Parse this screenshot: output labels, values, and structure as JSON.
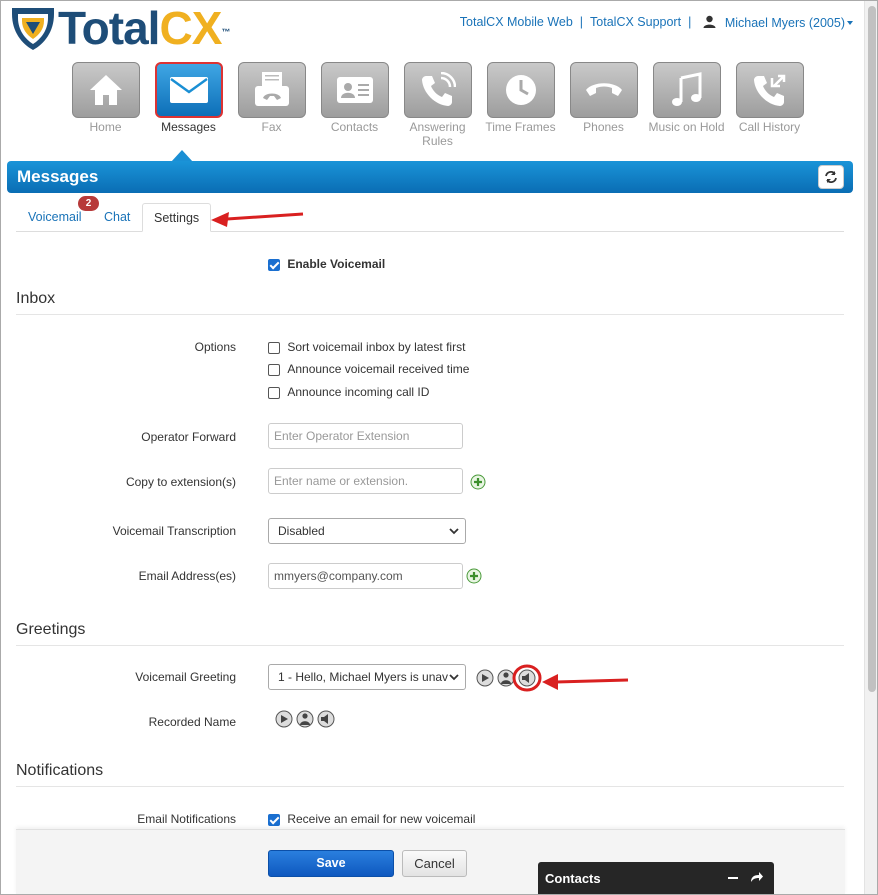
{
  "brand": {
    "name_part1": "Total",
    "name_part2": "CX",
    "tm": "™"
  },
  "toplinks": {
    "mobile": "TotalCX Mobile Web",
    "support": "TotalCX Support",
    "separator": "|",
    "user": "Michael Myers (2005)"
  },
  "nav": {
    "items": [
      {
        "label": "Home",
        "icon": "home-icon"
      },
      {
        "label": "Messages",
        "icon": "envelope-icon",
        "active": true
      },
      {
        "label": "Fax",
        "icon": "fax-icon"
      },
      {
        "label": "Contacts",
        "icon": "contact-card-icon"
      },
      {
        "label": "Answering Rules",
        "icon": "phone-rules-icon"
      },
      {
        "label": "Time Frames",
        "icon": "clock-icon"
      },
      {
        "label": "Phones",
        "icon": "handset-icon"
      },
      {
        "label": "Music on Hold",
        "icon": "music-note-icon"
      },
      {
        "label": "Call History",
        "icon": "call-history-icon"
      }
    ]
  },
  "title": "Messages",
  "tabs": {
    "voicemail": "Voicemail",
    "voicemail_badge": "2",
    "chat": "Chat",
    "settings": "Settings"
  },
  "form": {
    "enable_voicemail": "Enable Voicemail",
    "inbox_heading": "Inbox",
    "options_label": "Options",
    "options": [
      {
        "label": "Sort voicemail inbox by latest first",
        "checked": false
      },
      {
        "label": "Announce voicemail received time",
        "checked": false
      },
      {
        "label": "Announce incoming call ID",
        "checked": false
      }
    ],
    "operator_forward_label": "Operator Forward",
    "operator_forward_placeholder": "Enter Operator Extension",
    "copy_label": "Copy to extension(s)",
    "copy_placeholder": "Enter name or extension.",
    "transcription_label": "Voicemail Transcription",
    "transcription_value": "Disabled",
    "email_label": "Email Address(es)",
    "email_value": "mmyers@company.com",
    "greetings_heading": "Greetings",
    "greeting_label": "Voicemail Greeting",
    "greeting_value": "1 - Hello, Michael Myers is unav",
    "recorded_name_label": "Recorded Name",
    "notifications_heading": "Notifications",
    "email_notifications_label": "Email Notifications",
    "email_notifications_option": "Receive an email for new voicemail"
  },
  "footer": {
    "save": "Save",
    "cancel": "Cancel"
  },
  "contacts_panel": {
    "title": "Contacts"
  },
  "colors": {
    "accent": "#1a8fd4",
    "brand_blue": "#1e4d78",
    "brand_gold": "#f0b020",
    "link": "#1a73b8",
    "annotation_red": "#d92020"
  }
}
